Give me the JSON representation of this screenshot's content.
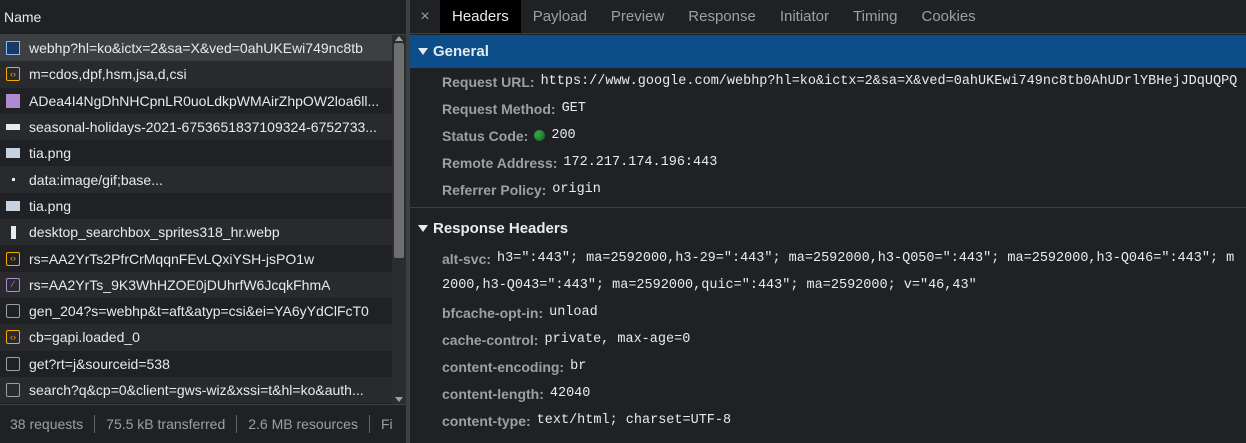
{
  "left": {
    "header": "Name",
    "requests": [
      {
        "name": "webhp?hl=ko&ictx=2&sa=X&ved=0ahUKEwi749nc8tb",
        "icon": "document-icon",
        "type": "doc",
        "selected": true
      },
      {
        "name": "m=cdos,dpf,hsm,jsa,d,csi",
        "icon": "script-icon",
        "type": "script"
      },
      {
        "name": "ADea4I4NgDhNHCpnLR0uoLdkpWMAirZhpOW2loa6ll...",
        "icon": "image-icon",
        "type": "img"
      },
      {
        "name": "seasonal-holidays-2021-6753651837109324-6752733...",
        "icon": "image-icon",
        "type": "white"
      },
      {
        "name": "tia.png",
        "icon": "image-icon",
        "type": "png"
      },
      {
        "name": "data:image/gif;base...",
        "icon": "image-icon",
        "type": "dot"
      },
      {
        "name": "tia.png",
        "icon": "image-icon",
        "type": "png"
      },
      {
        "name": "desktop_searchbox_sprites318_hr.webp",
        "icon": "image-icon",
        "type": "bar"
      },
      {
        "name": "rs=AA2YrTs2PfrCrMqqnFEvLQxiYSH-jsPO1w",
        "icon": "script-icon",
        "type": "script"
      },
      {
        "name": "rs=AA2YrTs_9K3WhHZOE0jDUhrfW6JcqkFhmA",
        "icon": "stylesheet-icon",
        "type": "purp"
      },
      {
        "name": "gen_204?s=webhp&t=aft&atyp=csi&ei=YA6yYdClFcT0",
        "icon": "other-icon",
        "type": "other"
      },
      {
        "name": "cb=gapi.loaded_0",
        "icon": "script-icon",
        "type": "script"
      },
      {
        "name": "get?rt=j&sourceid=538",
        "icon": "other-icon",
        "type": "other"
      },
      {
        "name": "search?q&cp=0&client=gws-wiz&xssi=t&hl=ko&auth...",
        "icon": "other-icon",
        "type": "other"
      }
    ],
    "status": {
      "requests": "38 requests",
      "transferred": "75.5 kB transferred",
      "resources": "2.6 MB resources",
      "finish": "Fi"
    }
  },
  "tabs": {
    "close": "×",
    "items": [
      "Headers",
      "Payload",
      "Preview",
      "Response",
      "Initiator",
      "Timing",
      "Cookies"
    ],
    "active": "Headers"
  },
  "general": {
    "title": "General",
    "request_url_key": "Request URL:",
    "request_url": "https://www.google.com/webhp?hl=ko&ictx=2&sa=X&ved=0ahUKEwi749nc8tb0AhUDrlYBHejJDqUQPQ",
    "method_key": "Request Method:",
    "method": "GET",
    "status_key": "Status Code:",
    "status": "200",
    "status_color": "#2ea043",
    "remote_key": "Remote Address:",
    "remote": "172.217.174.196:443",
    "referrer_key": "Referrer Policy:",
    "referrer": "origin"
  },
  "response_headers": {
    "title": "Response Headers",
    "alt_svc_key": "alt-svc:",
    "alt_svc_line1": "h3=\":443\"; ma=2592000,h3-29=\":443\"; ma=2592000,h3-Q050=\":443\"; ma=2592000,h3-Q046=\":443\"; m",
    "alt_svc_line2": "2000,h3-Q043=\":443\"; ma=2592000,quic=\":443\"; ma=2592000; v=\"46,43\"",
    "bfcache_key": "bfcache-opt-in:",
    "bfcache": "unload",
    "cache_key": "cache-control:",
    "cache": "private, max-age=0",
    "encoding_key": "content-encoding:",
    "encoding": "br",
    "length_key": "content-length:",
    "length": "42040",
    "type_key": "content-type:",
    "type": "text/html; charset=UTF-8"
  },
  "colors": {
    "accent": "#0b4e8a",
    "background": "#202124",
    "selected_row": "#3c4043"
  }
}
